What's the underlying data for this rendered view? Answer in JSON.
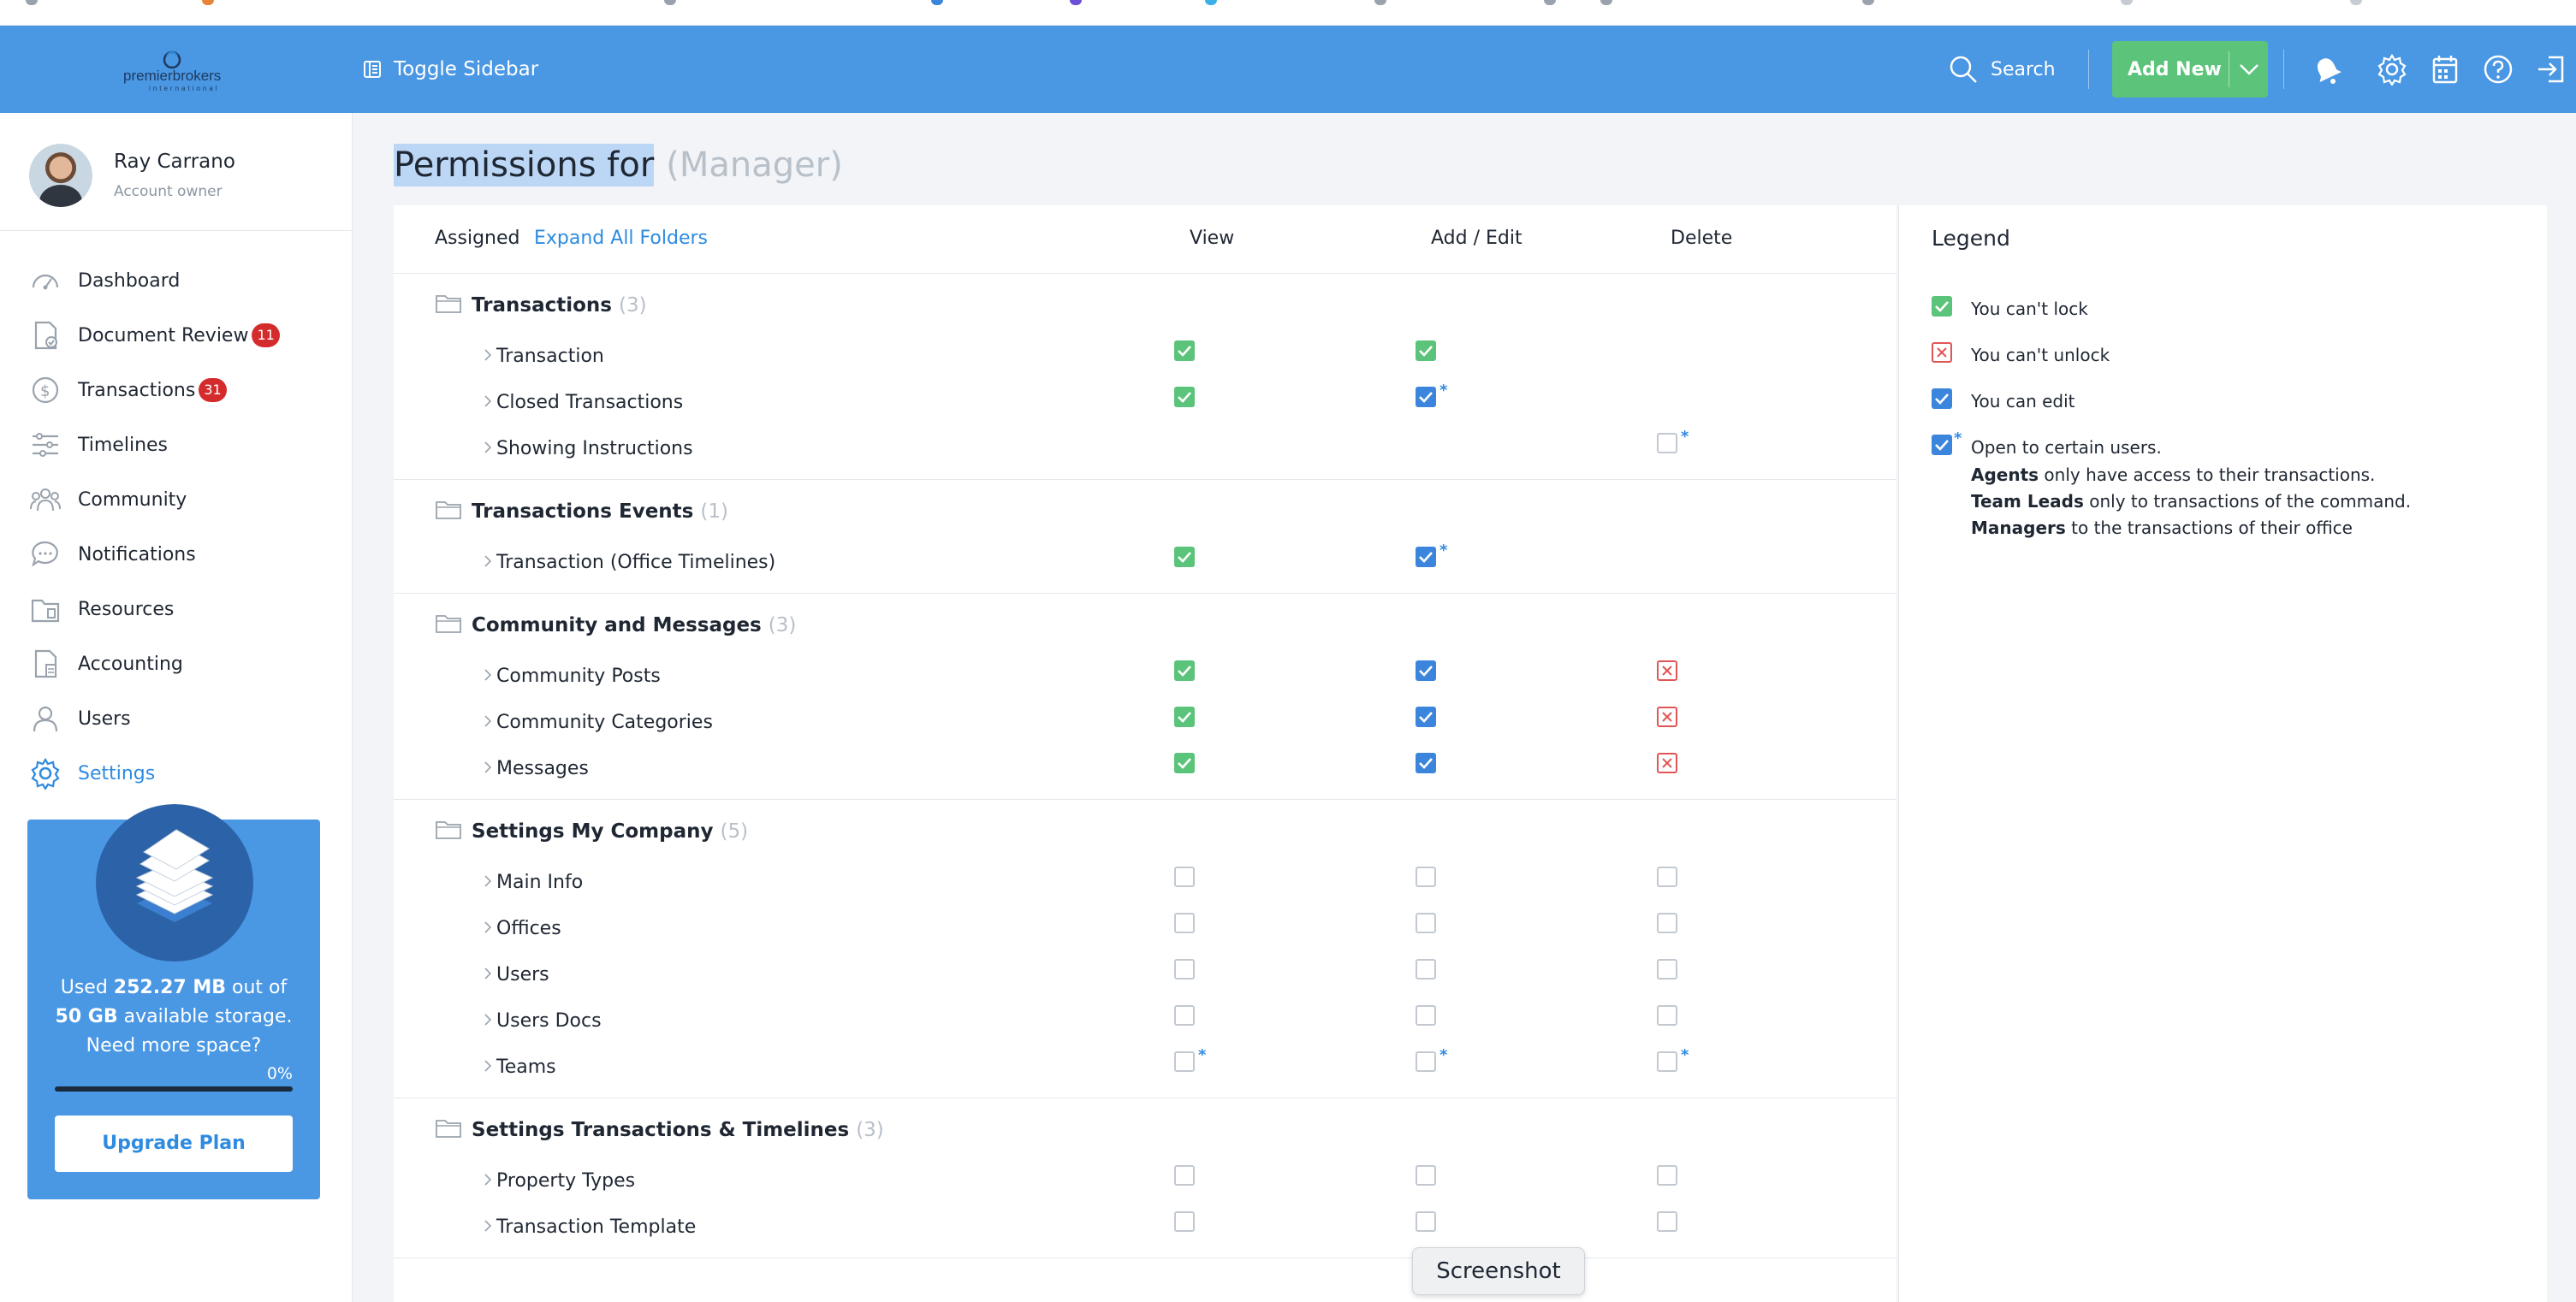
{
  "topbar": {
    "logo_text": "premierbrokers",
    "logo_sub": "international",
    "toggle_label": "Toggle Sidebar",
    "search_label": "Search",
    "add_new_label": "Add New",
    "accent_color": "#4a97e3",
    "add_new_color": "#5bc47a",
    "icons": [
      "bell-icon",
      "gear-icon",
      "calendar-icon",
      "help-icon",
      "logout-icon"
    ]
  },
  "profile": {
    "name": "Ray Carrano",
    "role": "Account owner"
  },
  "sidebar": {
    "items": [
      {
        "label": "Dashboard",
        "icon": "dashboard-icon",
        "badge": null,
        "active": false
      },
      {
        "label": "Document Review",
        "icon": "document-check-icon",
        "badge": "11",
        "active": false
      },
      {
        "label": "Transactions",
        "icon": "dollar-icon",
        "badge": "31",
        "active": false
      },
      {
        "label": "Timelines",
        "icon": "timeline-icon",
        "badge": null,
        "active": false
      },
      {
        "label": "Community",
        "icon": "community-icon",
        "badge": null,
        "active": false
      },
      {
        "label": "Notifications",
        "icon": "chat-bubble-icon",
        "badge": null,
        "active": false
      },
      {
        "label": "Resources",
        "icon": "folder-icon",
        "badge": null,
        "active": false
      },
      {
        "label": "Accounting",
        "icon": "accounting-icon",
        "badge": null,
        "active": false
      },
      {
        "label": "Users",
        "icon": "user-icon",
        "badge": null,
        "active": false
      },
      {
        "label": "Settings",
        "icon": "gear-icon",
        "badge": null,
        "active": true
      }
    ]
  },
  "storage": {
    "line1_pre": "Used ",
    "used": "252.27 MB",
    "line1_post": " out of",
    "total": "50 GB",
    "line2_post": " available storage.",
    "line3": "Need more space?",
    "percent_label": "0%",
    "percent": 0,
    "upgrade_label": "Upgrade Plan"
  },
  "page": {
    "title": "Permissions for",
    "subtitle": "(Manager)"
  },
  "table": {
    "col_assigned": "Assigned",
    "expand_label": "Expand All Folders",
    "col_view": "View",
    "col_add_edit": "Add / Edit",
    "col_delete": "Delete",
    "groups": [
      {
        "title": "Transactions",
        "count": "(3)",
        "rows": [
          {
            "label": "Transaction",
            "view": "green",
            "edit": "green",
            "delete": "none"
          },
          {
            "label": "Closed Transactions",
            "view": "green",
            "edit": "blue-star",
            "delete": "none"
          },
          {
            "label": "Showing Instructions",
            "view": "none",
            "edit": "none",
            "delete": "empty-star"
          }
        ]
      },
      {
        "title": "Transactions Events",
        "count": "(1)",
        "rows": [
          {
            "label": "Transaction (Office Timelines)",
            "view": "green",
            "edit": "blue-star",
            "delete": "none"
          }
        ]
      },
      {
        "title": "Community and Messages",
        "count": "(3)",
        "rows": [
          {
            "label": "Community Posts",
            "view": "green",
            "edit": "blue",
            "delete": "red"
          },
          {
            "label": "Community Categories",
            "view": "green",
            "edit": "blue",
            "delete": "red"
          },
          {
            "label": "Messages",
            "view": "green",
            "edit": "blue",
            "delete": "red"
          }
        ]
      },
      {
        "title": "Settings My Company",
        "count": "(5)",
        "rows": [
          {
            "label": "Main Info",
            "view": "empty",
            "edit": "empty",
            "delete": "empty"
          },
          {
            "label": "Offices",
            "view": "empty",
            "edit": "empty",
            "delete": "empty"
          },
          {
            "label": "Users",
            "view": "empty",
            "edit": "empty",
            "delete": "empty"
          },
          {
            "label": "Users Docs",
            "view": "empty",
            "edit": "empty",
            "delete": "empty"
          },
          {
            "label": "Teams",
            "view": "empty-star",
            "edit": "empty-star",
            "delete": "empty-star"
          }
        ]
      },
      {
        "title": "Settings Transactions & Timelines",
        "count": "(3)",
        "rows": [
          {
            "label": "Property Types",
            "view": "empty",
            "edit": "empty",
            "delete": "empty"
          },
          {
            "label": "Transaction Template",
            "view": "empty",
            "edit": "empty",
            "delete": "empty"
          }
        ]
      }
    ]
  },
  "legend": {
    "title": "Legend",
    "cant_lock": "You can't lock",
    "cant_unlock": "You can't unlock",
    "can_edit": "You can edit",
    "open_to": "Open to certain users.",
    "agents_b": "Agents",
    "agents_t": " only have access to their transactions.",
    "leads_b": "Team Leads",
    "leads_t": " only to transactions of the command.",
    "managers_b": "Managers",
    "managers_t": " to the transactions of their office"
  },
  "overlay": {
    "screenshot_label": "Screenshot"
  }
}
